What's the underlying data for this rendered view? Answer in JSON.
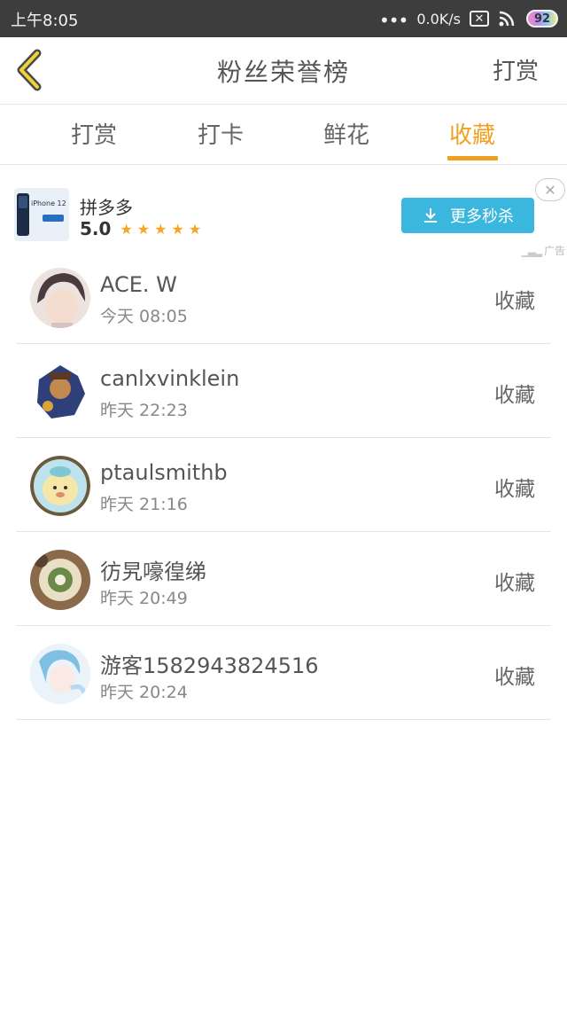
{
  "status_bar": {
    "time": "上午8:05",
    "dots": "•••",
    "net_speed": "0.0K/s",
    "sim_icon_text": "✕",
    "battery": "92"
  },
  "header": {
    "title": "粉丝荣誉榜",
    "right_action": "打赏"
  },
  "tabs": [
    {
      "label": "打赏"
    },
    {
      "label": "打卡"
    },
    {
      "label": "鲜花"
    },
    {
      "label": "收藏"
    }
  ],
  "active_tab": "收藏",
  "ad": {
    "app_name": "拼多多",
    "rating": "5.0",
    "stars": "★★★★★",
    "button_label": "更多秒杀",
    "close_glyph": "✕",
    "tag": "广告",
    "thumb_text": "iPhone 12"
  },
  "fans": [
    {
      "name": "ACE. W",
      "time": "今天 08:05",
      "action": "收藏"
    },
    {
      "name": "canlxvinklein",
      "time": "昨天 22:23",
      "action": "收藏"
    },
    {
      "name": "ptaulsmithb",
      "time": "昨天 21:16",
      "action": "收藏"
    },
    {
      "name": "彷旯嚎徨绨",
      "time": "昨天 20:49",
      "action": "收藏"
    },
    {
      "name": "游客1582943824516",
      "time": "昨天 20:24",
      "action": "收藏"
    }
  ],
  "colors": {
    "accent": "#f0a020",
    "ad_button": "#3bb6de",
    "status_bar": "#3d3d3d"
  }
}
